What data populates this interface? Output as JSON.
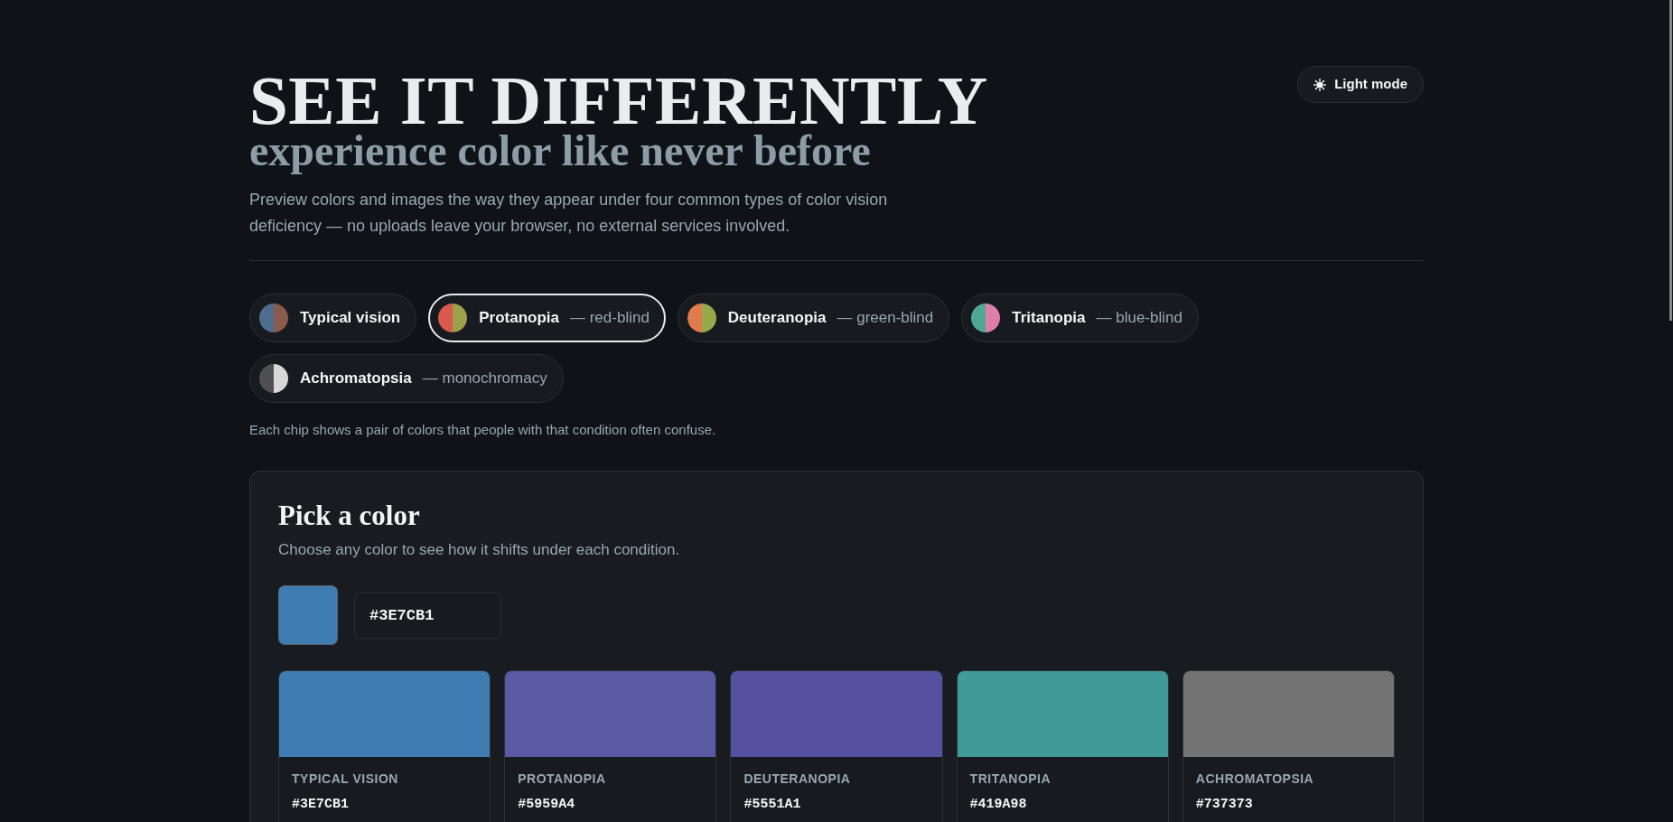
{
  "header": {
    "title": "SEE IT DIFFERENTLY",
    "subtitle": "experience color like never before",
    "description": "Preview colors and images the way they appear under four common types of color vision deficiency — no uploads leave your browser, no external services involved."
  },
  "theme_button": {
    "label": "Light mode"
  },
  "chips": [
    {
      "name": "Typical vision",
      "halves": [
        {
          "color": "#4f6d8f"
        },
        {
          "color": "#8a5a4c"
        }
      ],
      "selected": false
    },
    {
      "name": "Protanopia",
      "detail": "— red-blind",
      "halves": [
        {
          "color": "#d9594f"
        },
        {
          "color": "#9ea04c"
        }
      ],
      "selected": true
    },
    {
      "name": "Deuteranopia",
      "detail": "— green-blind",
      "halves": [
        {
          "color": "#e07b4c"
        },
        {
          "color": "#9aa84c"
        }
      ],
      "selected": false
    },
    {
      "name": "Tritanopia",
      "detail": "— blue-blind",
      "halves": [
        {
          "color": "#4fa895"
        },
        {
          "color": "#de7fab"
        }
      ],
      "selected": false
    },
    {
      "name": "Achromatopsia",
      "detail": "— monochromacy",
      "halves": [
        {
          "color": "#505050"
        },
        {
          "color": "#d8d8d8"
        }
      ],
      "selected": false
    }
  ],
  "chips_note": "Each chip shows a pair of colors that people with that condition often confuse.",
  "picker": {
    "title": "Pick a color",
    "description": "Choose any color to see how it shifts under each condition.",
    "color": "#3e7cb1",
    "value": "#3E7CB1"
  },
  "swatches": [
    {
      "label": "TYPICAL VISION",
      "hex": "#3E7CB1",
      "color": "#3e7cb1"
    },
    {
      "label": "PROTANOPIA",
      "hex": "#5959A4",
      "color": "#5959a4"
    },
    {
      "label": "DEUTERANOPIA",
      "hex": "#5551A1",
      "color": "#5551a1"
    },
    {
      "label": "TRITANOPIA",
      "hex": "#419A98",
      "color": "#419a98"
    },
    {
      "label": "ACHROMATOPSIA",
      "hex": "#737373",
      "color": "#737373"
    }
  ]
}
